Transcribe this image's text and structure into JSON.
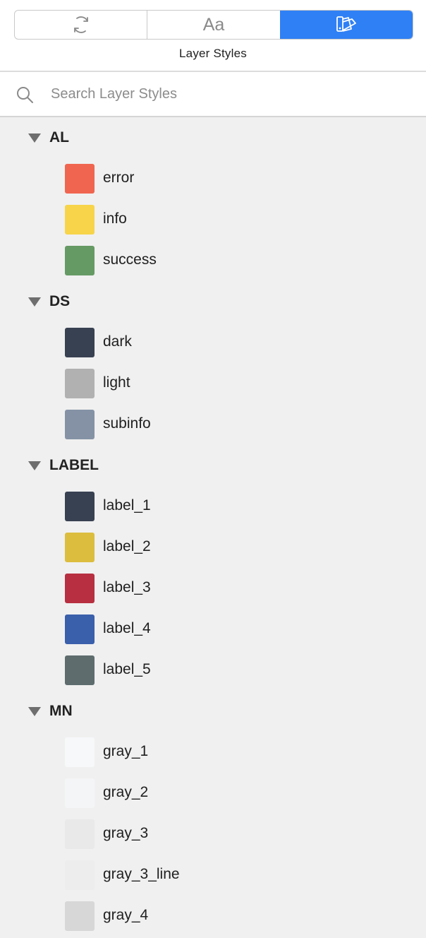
{
  "header": {
    "title": "Layer Styles",
    "tabs": [
      {
        "name": "sync",
        "icon": "sync-icon",
        "active": false
      },
      {
        "name": "text-styles",
        "icon": "text-style-icon",
        "glyph": "Aa",
        "active": false
      },
      {
        "name": "layer-styles",
        "icon": "layer-styles-icon",
        "active": true
      }
    ]
  },
  "search": {
    "placeholder": "Search Layer Styles",
    "value": ""
  },
  "groups": [
    {
      "label": "AL",
      "items": [
        {
          "label": "error",
          "color": "#f0654f"
        },
        {
          "label": "info",
          "color": "#f7d44a"
        },
        {
          "label": "success",
          "color": "#659a64"
        }
      ]
    },
    {
      "label": "DS",
      "items": [
        {
          "label": "dark",
          "color": "#384152"
        },
        {
          "label": "light",
          "color": "#b1b1b1"
        },
        {
          "label": "subinfo",
          "color": "#8592a6"
        }
      ]
    },
    {
      "label": "LABEL",
      "items": [
        {
          "label": "label_1",
          "color": "#384152"
        },
        {
          "label": "label_2",
          "color": "#dcbd3e"
        },
        {
          "label": "label_3",
          "color": "#b72f41"
        },
        {
          "label": "label_4",
          "color": "#3a5fab"
        },
        {
          "label": "label_5",
          "color": "#5e6c6e"
        }
      ]
    },
    {
      "label": "MN",
      "items": [
        {
          "label": "gray_1",
          "color": "#f7f8fa"
        },
        {
          "label": "gray_2",
          "color": "#f4f5f7"
        },
        {
          "label": "gray_3",
          "color": "#e9e9e9"
        },
        {
          "label": "gray_3_line",
          "color": "#ededed"
        },
        {
          "label": "gray_4",
          "color": "#d7d7d7"
        }
      ]
    }
  ]
}
